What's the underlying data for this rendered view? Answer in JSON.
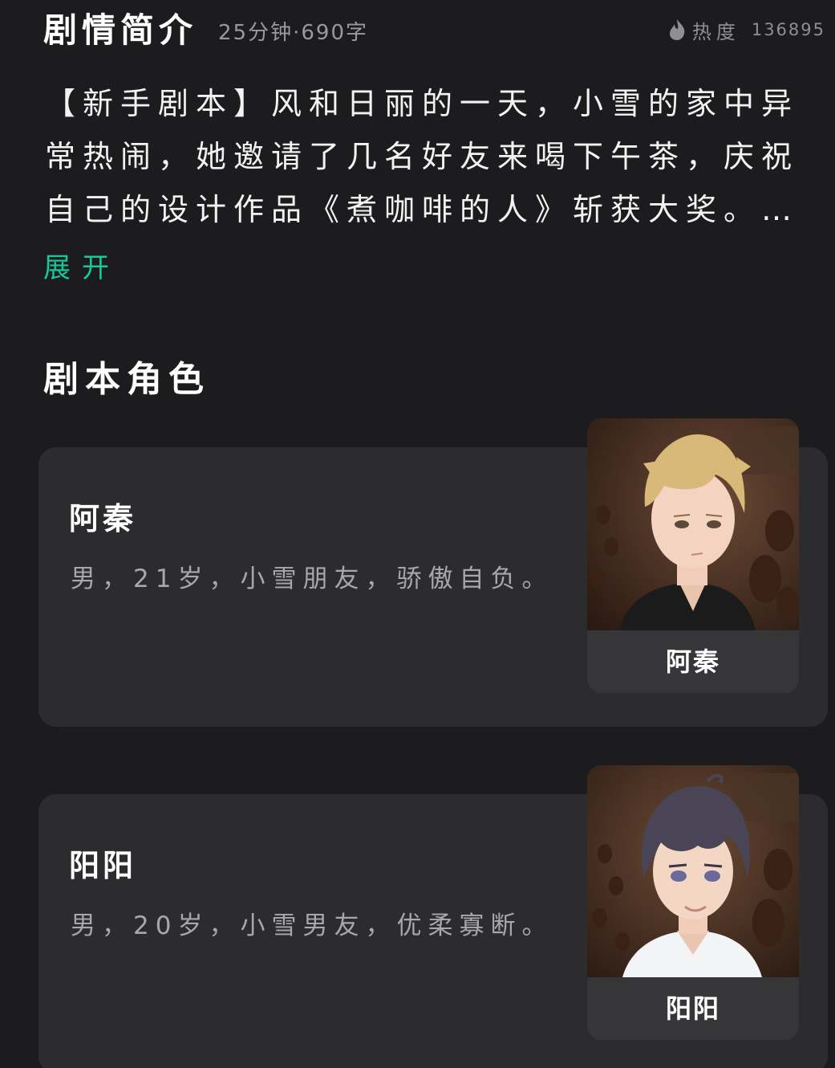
{
  "intro": {
    "title": "剧情简介",
    "meta": "25分钟·690字",
    "heat_icon": "flame-icon",
    "heat_label": "热度",
    "heat_value": "136895",
    "synopsis": "【新手剧本】风和日丽的一天，小雪的家中异常热闹，她邀请了几名好友来喝下午茶，庆祝自己的设计作品《煮咖啡的人》斩获大奖。…",
    "expand_label": "展开",
    "accent_color": "#16c79a"
  },
  "roles": {
    "title": "剧本角色",
    "items": [
      {
        "name": "阿秦",
        "description": "男，21岁，小雪朋友，骄傲自负。",
        "portrait_label": "阿秦",
        "portrait_icon": "character-portrait-blond"
      },
      {
        "name": "阳阳",
        "description": "男，20岁，小雪男友，优柔寡断。",
        "portrait_label": "阳阳",
        "portrait_icon": "character-portrait-dark-hair"
      }
    ]
  }
}
